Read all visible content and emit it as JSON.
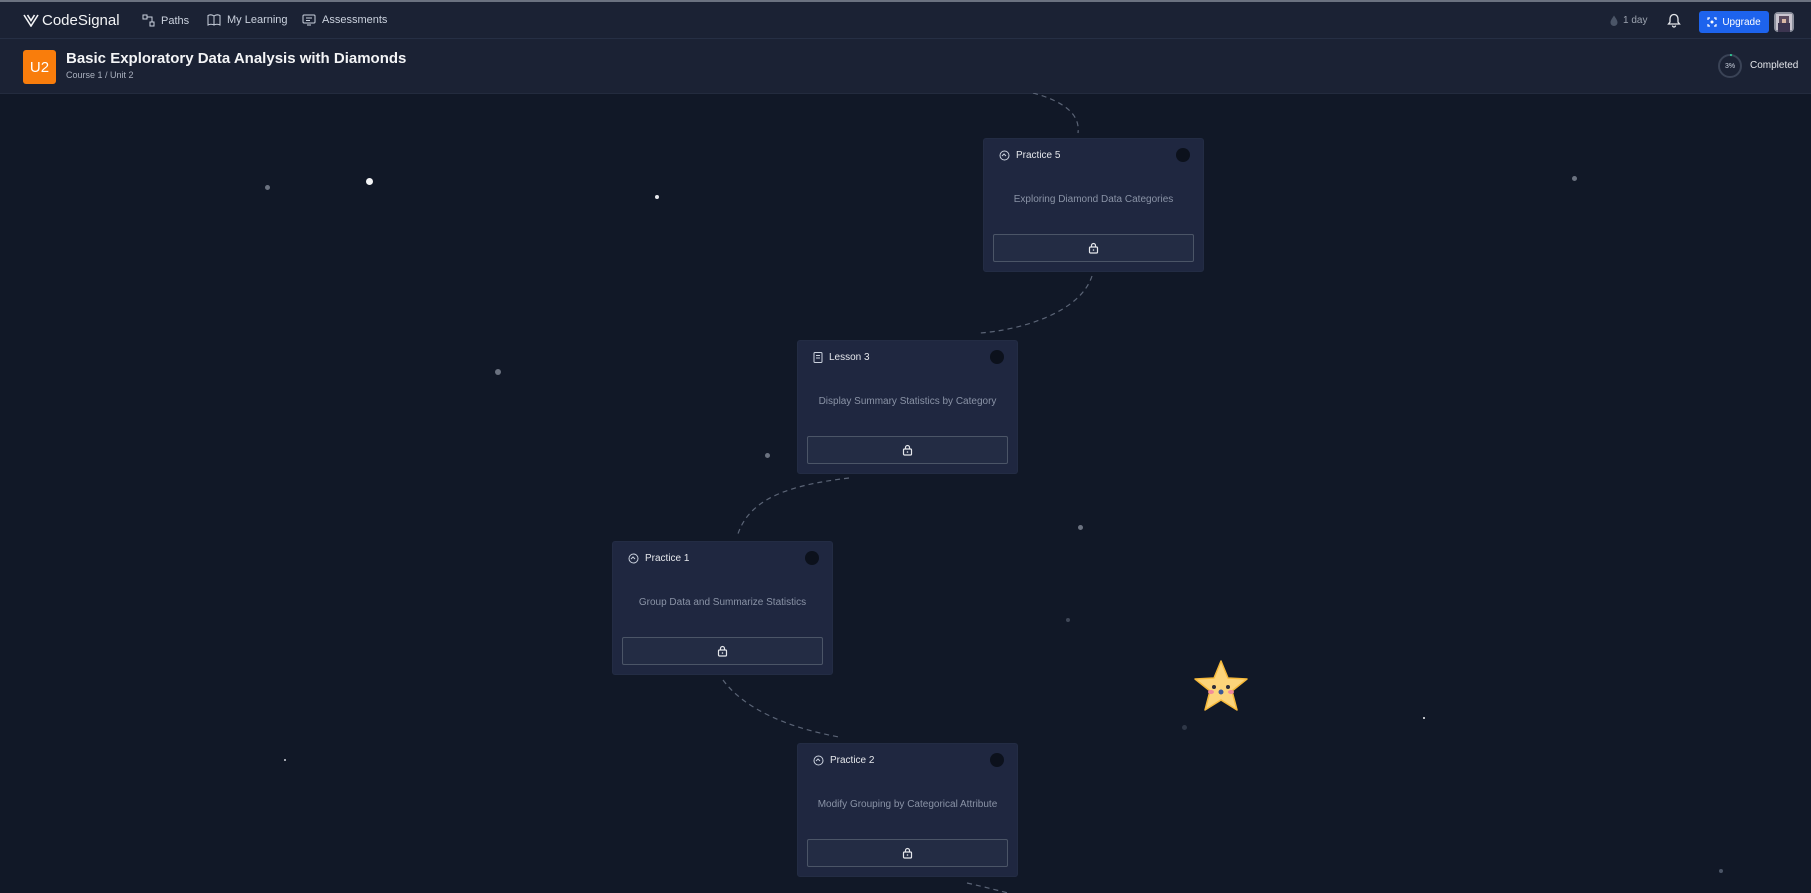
{
  "header": {
    "brand": "CodeSignal",
    "nav": [
      {
        "label": "Paths",
        "icon": "paths-icon"
      },
      {
        "label": "My Learning",
        "icon": "book-icon"
      },
      {
        "label": "Assessments",
        "icon": "assessment-icon"
      }
    ],
    "streak": "1 day",
    "upgrade_label": "Upgrade"
  },
  "unit": {
    "badge": "U2",
    "title": "Basic Exploratory Data Analysis with Diamonds",
    "subtitle": "Course 1 / Unit 2",
    "progress": "3%",
    "progress_value": 0.03,
    "completed_label": "Completed"
  },
  "cards": [
    {
      "type": "Practice 5",
      "icon": "practice-icon",
      "title": "Exploring Diamond Data Categories",
      "locked": true
    },
    {
      "type": "Lesson 3",
      "icon": "lesson-icon",
      "title": "Display Summary Statistics by Category",
      "locked": true
    },
    {
      "type": "Practice 1",
      "icon": "practice-icon",
      "title": "Group Data and Summarize Statistics",
      "locked": true
    },
    {
      "type": "Practice 2",
      "icon": "practice-icon",
      "title": "Modify Grouping by Categorical Attribute",
      "locked": true
    }
  ],
  "colors": {
    "background": "#111827",
    "card": "#1f2740",
    "accent": "#1d63ed",
    "badge": "#f97d0c"
  }
}
